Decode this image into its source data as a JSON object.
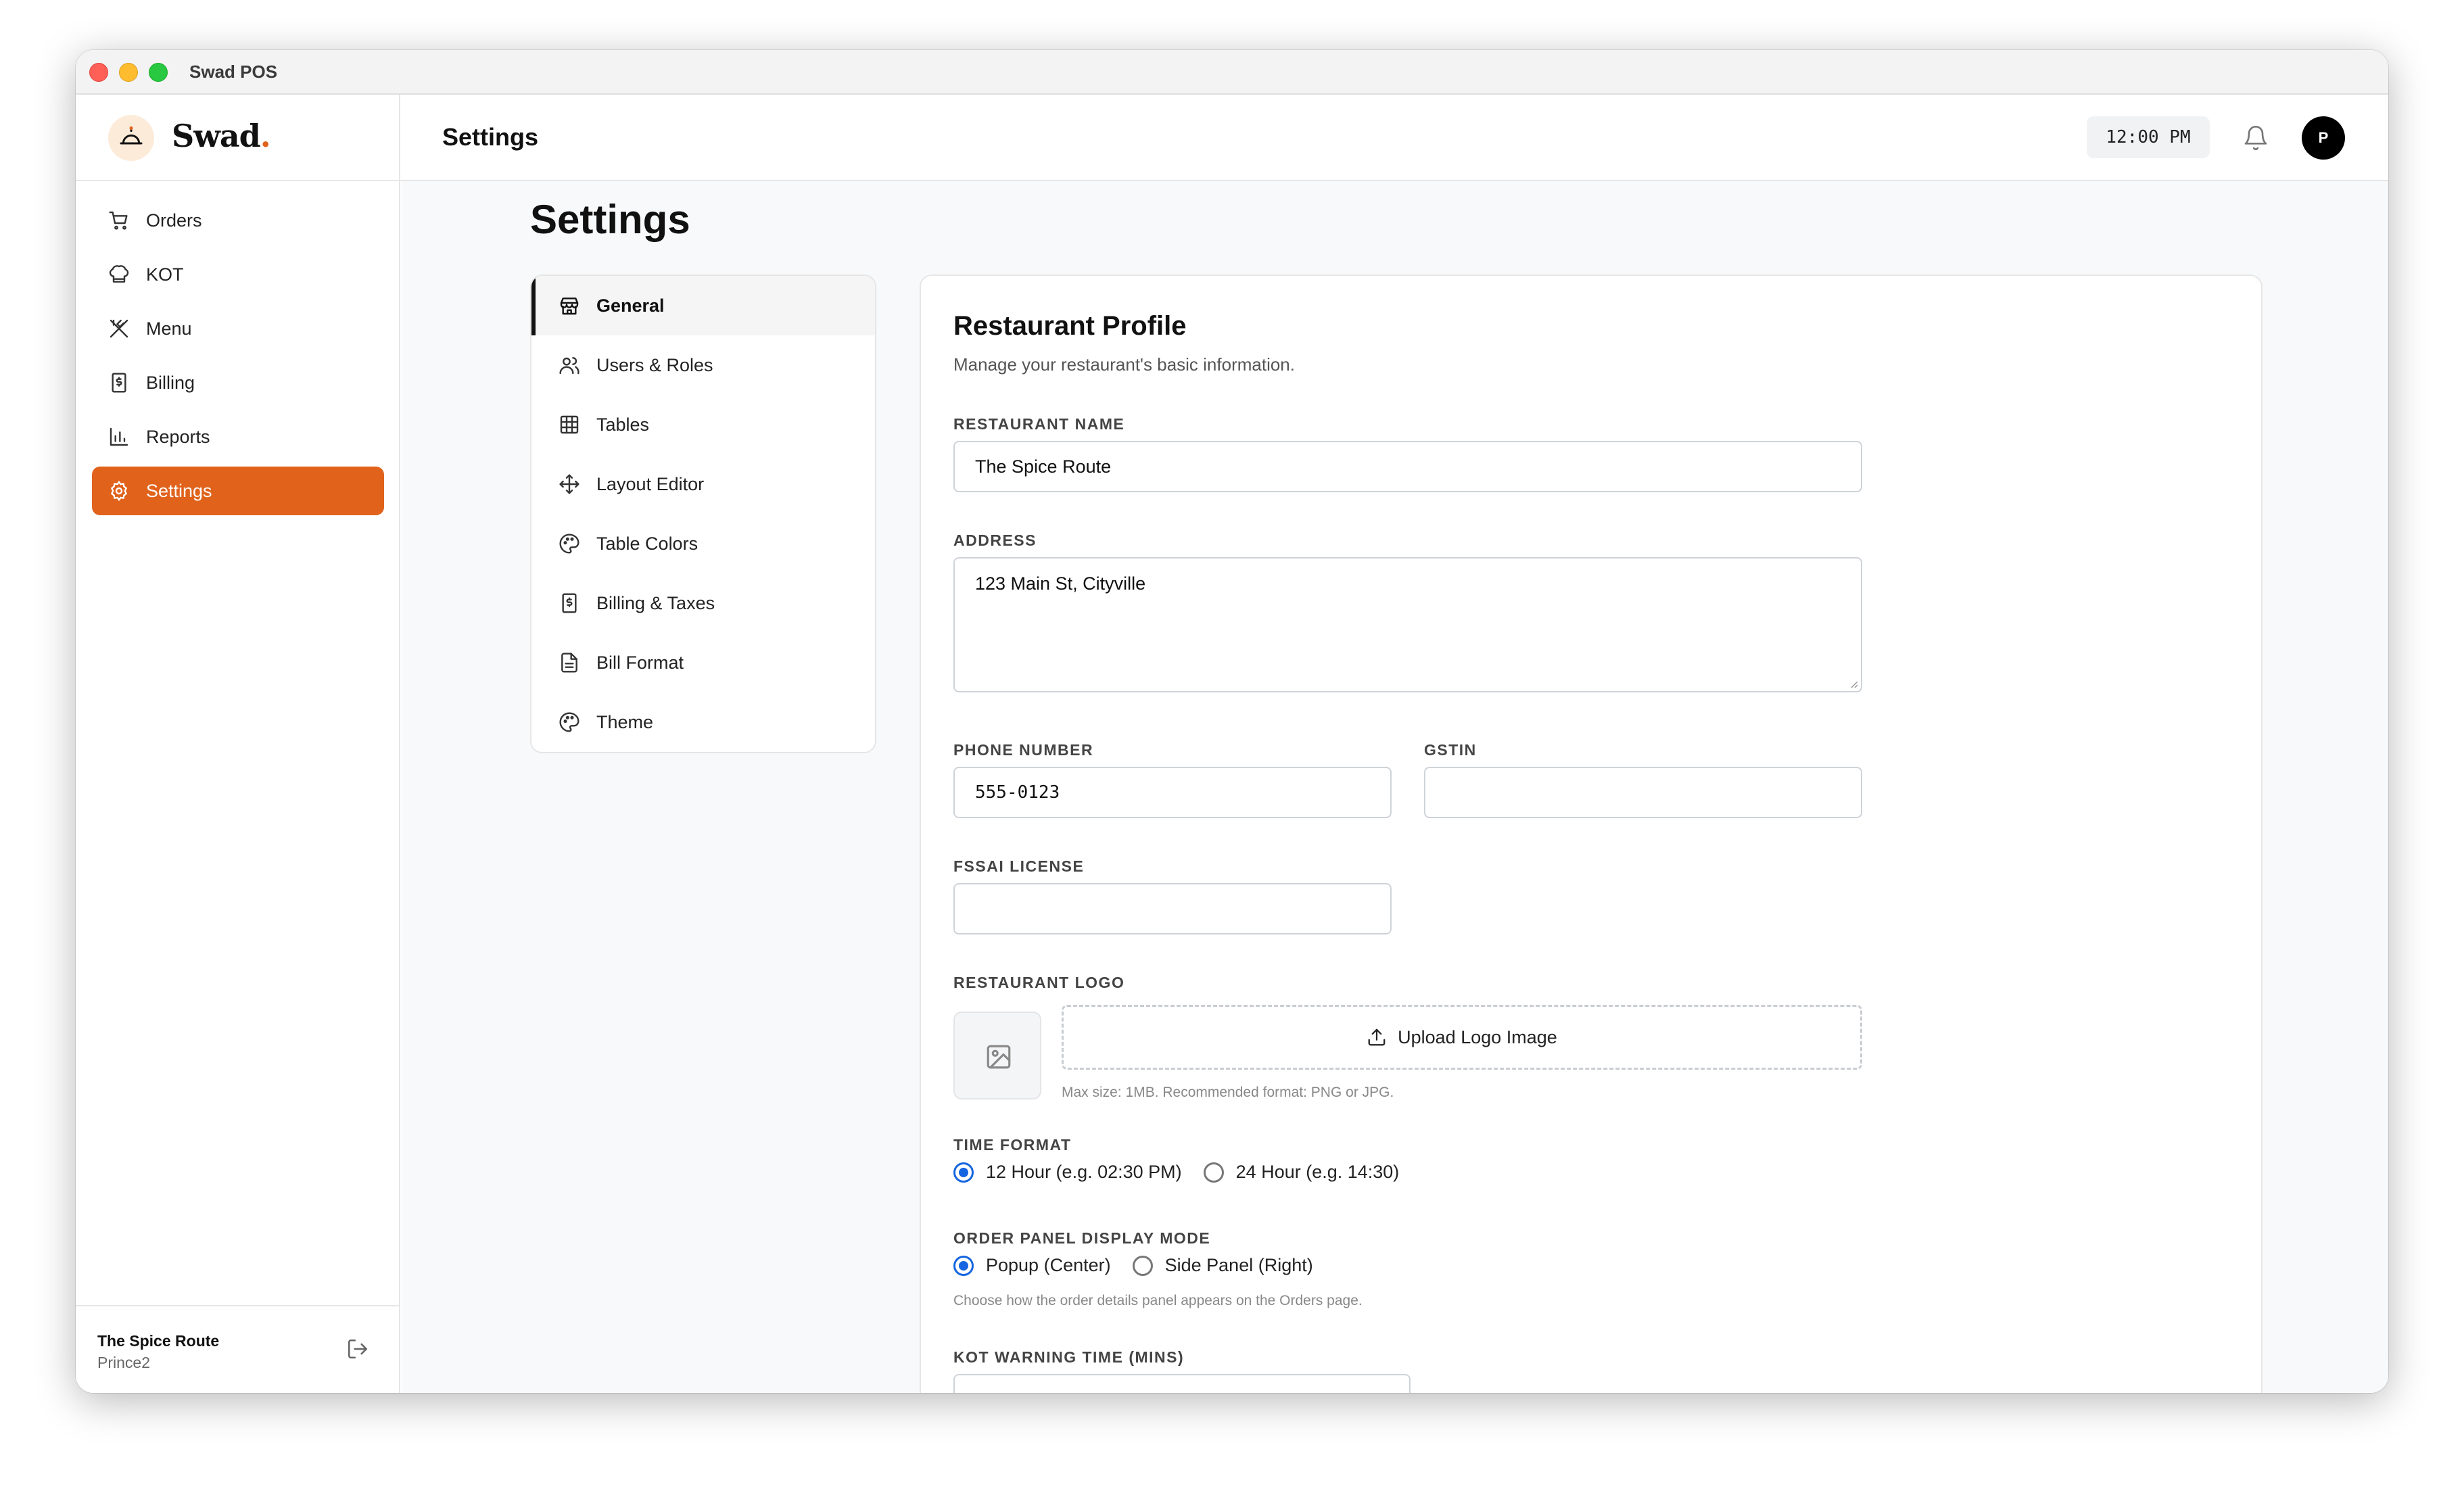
{
  "window": {
    "title": "Swad POS"
  },
  "brand": {
    "name": "Swad",
    "dot": "."
  },
  "sidebar": {
    "items": [
      {
        "label": "Orders",
        "icon": "cart-icon"
      },
      {
        "label": "KOT",
        "icon": "chef-hat-icon"
      },
      {
        "label": "Menu",
        "icon": "utensils-icon"
      },
      {
        "label": "Billing",
        "icon": "receipt-icon"
      },
      {
        "label": "Reports",
        "icon": "bar-chart-icon"
      },
      {
        "label": "Settings",
        "icon": "gear-icon",
        "active": true
      }
    ],
    "footer": {
      "restaurant": "The Spice Route",
      "user": "Prince2"
    }
  },
  "header": {
    "title": "Settings",
    "clock": "12:00 PM",
    "avatar_initial": "P"
  },
  "page": {
    "title": "Settings"
  },
  "settings_nav": {
    "items": [
      {
        "label": "General",
        "icon": "store-icon",
        "active": true
      },
      {
        "label": "Users & Roles",
        "icon": "users-icon"
      },
      {
        "label": "Tables",
        "icon": "grid-icon"
      },
      {
        "label": "Layout Editor",
        "icon": "move-icon"
      },
      {
        "label": "Table Colors",
        "icon": "palette-icon"
      },
      {
        "label": "Billing & Taxes",
        "icon": "receipt-icon"
      },
      {
        "label": "Bill Format",
        "icon": "file-icon"
      },
      {
        "label": "Theme",
        "icon": "palette-icon"
      }
    ]
  },
  "profile": {
    "title": "Restaurant Profile",
    "subtitle": "Manage your restaurant's basic information.",
    "name_label": "RESTAURANT NAME",
    "name_value": "The Spice Route",
    "address_label": "ADDRESS",
    "address_value": "123 Main St, Cityville",
    "phone_label": "PHONE NUMBER",
    "phone_value": "555-0123",
    "gstin_label": "GSTIN",
    "gstin_value": "",
    "fssai_label": "FSSAI LICENSE",
    "fssai_value": "",
    "logo_label": "RESTAURANT LOGO",
    "upload_label": "Upload Logo Image",
    "upload_hint": "Max size: 1MB. Recommended format: PNG or JPG.",
    "time_format_label": "TIME FORMAT",
    "time_format_options": [
      "12 Hour (e.g. 02:30 PM)",
      "24 Hour (e.g. 14:30)"
    ],
    "time_format_selected": "12 Hour (e.g. 02:30 PM)",
    "panel_mode_label": "ORDER PANEL DISPLAY MODE",
    "panel_mode_options": [
      "Popup (Center)",
      "Side Panel (Right)"
    ],
    "panel_mode_selected": "Popup (Center)",
    "panel_mode_hint": "Choose how the order details panel appears on the Orders page.",
    "kot_warning_label": "KOT WARNING TIME (MINS)"
  },
  "colors": {
    "accent": "#e0621b",
    "radio_selected": "#1565e0",
    "main_bg": "#f8f9fa"
  }
}
